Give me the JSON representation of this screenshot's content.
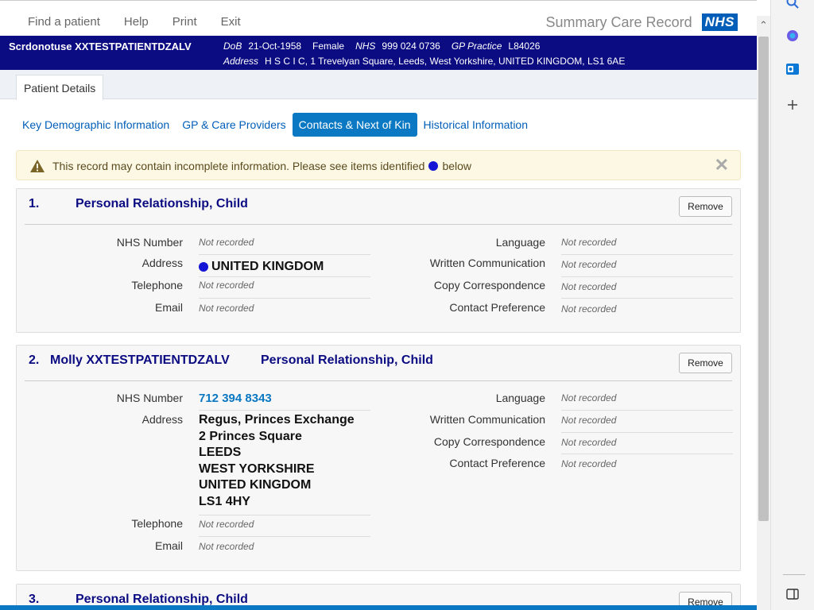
{
  "topnav": {
    "items": [
      "Find a patient",
      "Help",
      "Print",
      "Exit"
    ],
    "brand_title": "Summary Care Record",
    "logo_text": "NHS"
  },
  "patient": {
    "name": "Scrdonotuse XXTESTPATIENTDZALV",
    "dob_label": "DoB",
    "dob": "21-Oct-1958",
    "gender": "Female",
    "nhs_label": "NHS",
    "nhs": "999 024 0736",
    "gp_label": "GP Practice",
    "gp": "L84026",
    "address_label": "Address",
    "address": "H S C I C, 1 Trevelyan Square, Leeds, West Yorkshire, UNITED KINGDOM, LS1 6AE"
  },
  "tab": {
    "label": "Patient Details"
  },
  "subtabs": [
    {
      "label": "Key Demographic Information",
      "active": false
    },
    {
      "label": "GP & Care Providers",
      "active": false
    },
    {
      "label": "Contacts & Next of Kin",
      "active": true
    },
    {
      "label": "Historical Information",
      "active": false
    }
  ],
  "alert": {
    "text_before": "This record may contain incomplete information. Please see items identified",
    "text_after": "below",
    "close_symbol": "✕"
  },
  "labels": {
    "nhs_number": "NHS Number",
    "address": "Address",
    "telephone": "Telephone",
    "email": "Email",
    "language": "Language",
    "written_communication": "Written Communication",
    "copy_correspondence": "Copy Correspondence",
    "contact_preference": "Contact Preference",
    "not_recorded": "Not recorded",
    "remove": "Remove"
  },
  "contacts": [
    {
      "number": "1.",
      "name": "",
      "relationship": "Personal Relationship, Child",
      "nhs_number": "Not recorded",
      "address_lines": [
        "UNITED KINGDOM"
      ],
      "address_flag": true,
      "telephone": "Not recorded",
      "email": "Not recorded",
      "language": "Not recorded",
      "written_communication": "Not recorded",
      "copy_correspondence": "Not recorded",
      "contact_preference": "Not recorded"
    },
    {
      "number": "2.",
      "name": "Molly XXTESTPATIENTDZALV",
      "relationship": "Personal Relationship, Child",
      "nhs_number": "712 394 8343",
      "address_lines": [
        "Regus, Princes Exchange",
        "2 Princes Square",
        "LEEDS",
        "WEST YORKSHIRE",
        "UNITED KINGDOM",
        "LS1 4HY"
      ],
      "address_flag": false,
      "telephone": "Not recorded",
      "email": "Not recorded",
      "language": "Not recorded",
      "written_communication": "Not recorded",
      "copy_correspondence": "Not recorded",
      "contact_preference": "Not recorded"
    },
    {
      "number": "3.",
      "name": "",
      "relationship": "Personal Relationship, Child"
    }
  ],
  "sidepanel": {
    "icons": [
      "search-icon",
      "copilot-icon",
      "outlook-icon",
      "add-icon",
      "sidebar-toggle-icon"
    ]
  },
  "colors": {
    "banner": "#0b0b82",
    "accent": "#0a78c2",
    "heading": "#0b0b82",
    "alert_bg": "#fcf8e3",
    "flag_dot": "#1515d6",
    "nhs_blue": "#005eb8"
  }
}
